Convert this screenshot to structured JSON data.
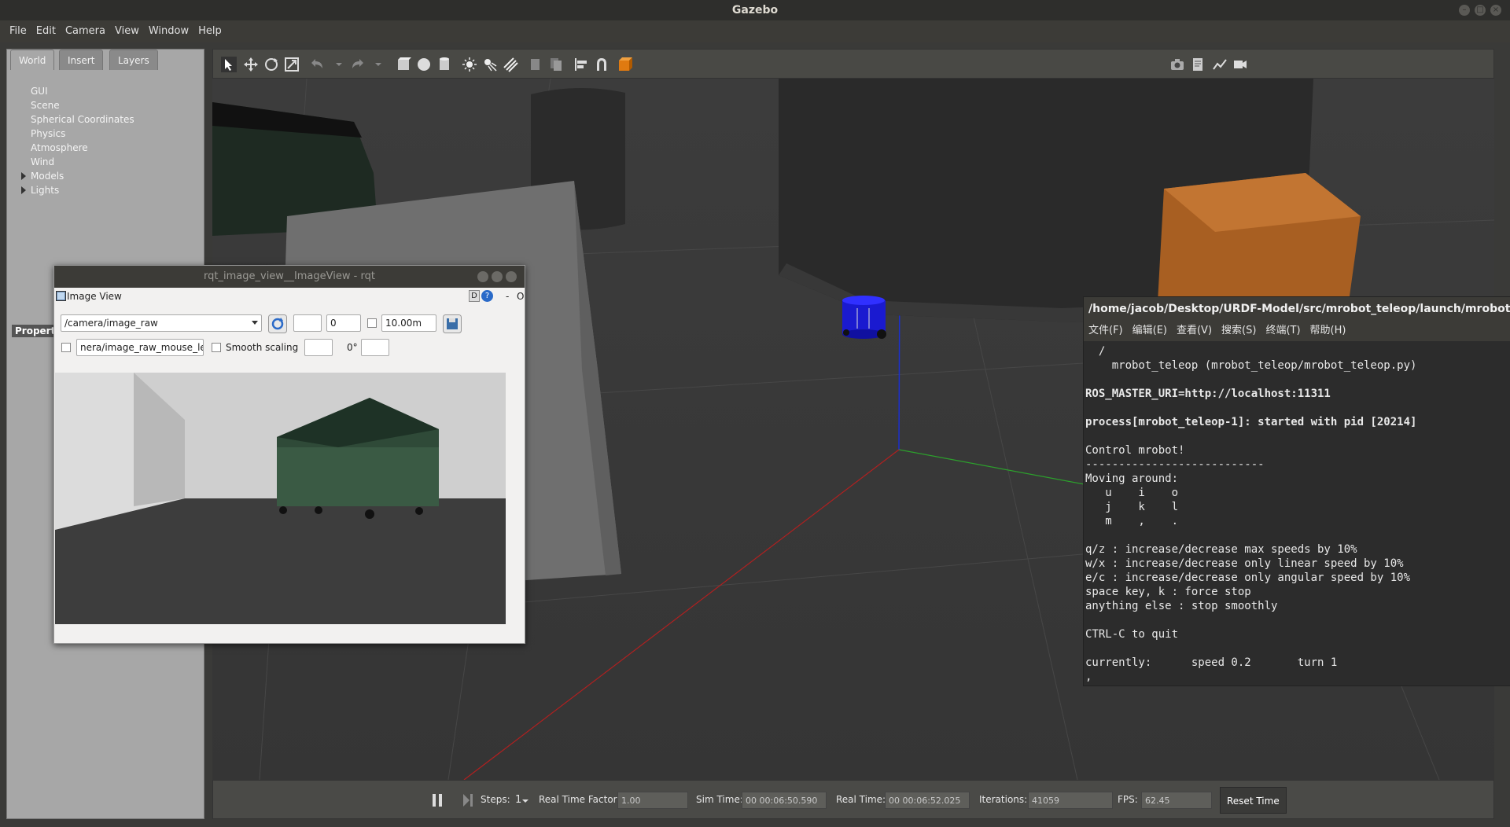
{
  "window": {
    "title": "Gazebo"
  },
  "menubar": [
    "File",
    "Edit",
    "Camera",
    "View",
    "Window",
    "Help"
  ],
  "left_panel": {
    "tabs": [
      "World",
      "Insert",
      "Layers"
    ],
    "active_tab": "World",
    "tree": [
      "GUI",
      "Scene",
      "Spherical Coordinates",
      "Physics",
      "Atmosphere",
      "Wind",
      "Models",
      "Lights"
    ],
    "property_label": "Property"
  },
  "toolbar": {
    "icons": [
      "select-icon",
      "translate-icon",
      "rotate-icon",
      "scale-icon",
      "undo-icon",
      "redo-icon",
      "box-icon",
      "sphere-icon",
      "cylinder-icon",
      "point-light-icon",
      "spot-light-icon",
      "directional-light-icon",
      "copy-icon",
      "paste-icon",
      "align-icon",
      "snap-icon",
      "view-angle-icon",
      "screenshot-icon",
      "log-icon",
      "plot-icon",
      "record-icon"
    ]
  },
  "bottom_bar": {
    "steps_label": "Steps:",
    "steps_value": "1",
    "rtf_label": "Real Time Factor:",
    "rtf_value": "1.00",
    "sim_time_label": "Sim Time:",
    "sim_time_value": "00 00:06:50.590",
    "real_time_label": "Real Time:",
    "real_time_value": "00 00:06:52.025",
    "iterations_label": "Iterations:",
    "iterations_value": "41059",
    "fps_label": "FPS:",
    "fps_value": "62.45",
    "reset_label": "Reset Time"
  },
  "rqt": {
    "title": "rqt_image_view__ImageView - rqt",
    "plugin_title": "Image View",
    "header_buttons": [
      "D",
      "?",
      "-",
      "O"
    ],
    "topic": "/camera/image_raw",
    "spin_value": "0",
    "distance_value": "10.00m",
    "mouse_topic": "nera/image_raw_mouse_left",
    "smooth_scaling": "Smooth scaling",
    "rotation": "0°"
  },
  "terminal": {
    "title": "/home/jacob/Desktop/URDF-Model/src/mrobot_teleop/launch/mrobot_teleop.launch",
    "menu": [
      "文件(F)",
      "编辑(E)",
      "查看(V)",
      "搜索(S)",
      "终端(T)",
      "帮助(H)"
    ],
    "lines": [
      {
        "text": "  /",
        "bold": false
      },
      {
        "text": "    mrobot_teleop (mrobot_teleop/mrobot_teleop.py)",
        "bold": false
      },
      {
        "text": "",
        "bold": false
      },
      {
        "text": "ROS_MASTER_URI=http://localhost:11311",
        "bold": true
      },
      {
        "text": "",
        "bold": false
      },
      {
        "text": "process[mrobot_teleop-1]: started with pid [20214]",
        "bold": true
      },
      {
        "text": "",
        "bold": false
      },
      {
        "text": "Control mrobot!",
        "bold": false
      },
      {
        "text": "---------------------------",
        "bold": false
      },
      {
        "text": "Moving around:",
        "bold": false
      },
      {
        "text": "   u    i    o",
        "bold": false
      },
      {
        "text": "   j    k    l",
        "bold": false
      },
      {
        "text": "   m    ,    .",
        "bold": false
      },
      {
        "text": "",
        "bold": false
      },
      {
        "text": "q/z : increase/decrease max speeds by 10%",
        "bold": false
      },
      {
        "text": "w/x : increase/decrease only linear speed by 10%",
        "bold": false
      },
      {
        "text": "e/c : increase/decrease only angular speed by 10%",
        "bold": false
      },
      {
        "text": "space key, k : force stop",
        "bold": false
      },
      {
        "text": "anything else : stop smoothly",
        "bold": false
      },
      {
        "text": "",
        "bold": false
      },
      {
        "text": "CTRL-C to quit",
        "bold": false
      },
      {
        "text": "",
        "bold": false
      },
      {
        "text": "currently:      speed 0.2       turn 1",
        "bold": false
      },
      {
        "text": ",",
        "bold": false
      }
    ]
  },
  "colors": {
    "gazebo_bg": "#3b3b3b",
    "panel_bg": "#a7a7a7",
    "terminal_bg": "#2c2c2c",
    "robot_blue": "#1a1ad0",
    "crate_orange": "#a85f22"
  }
}
